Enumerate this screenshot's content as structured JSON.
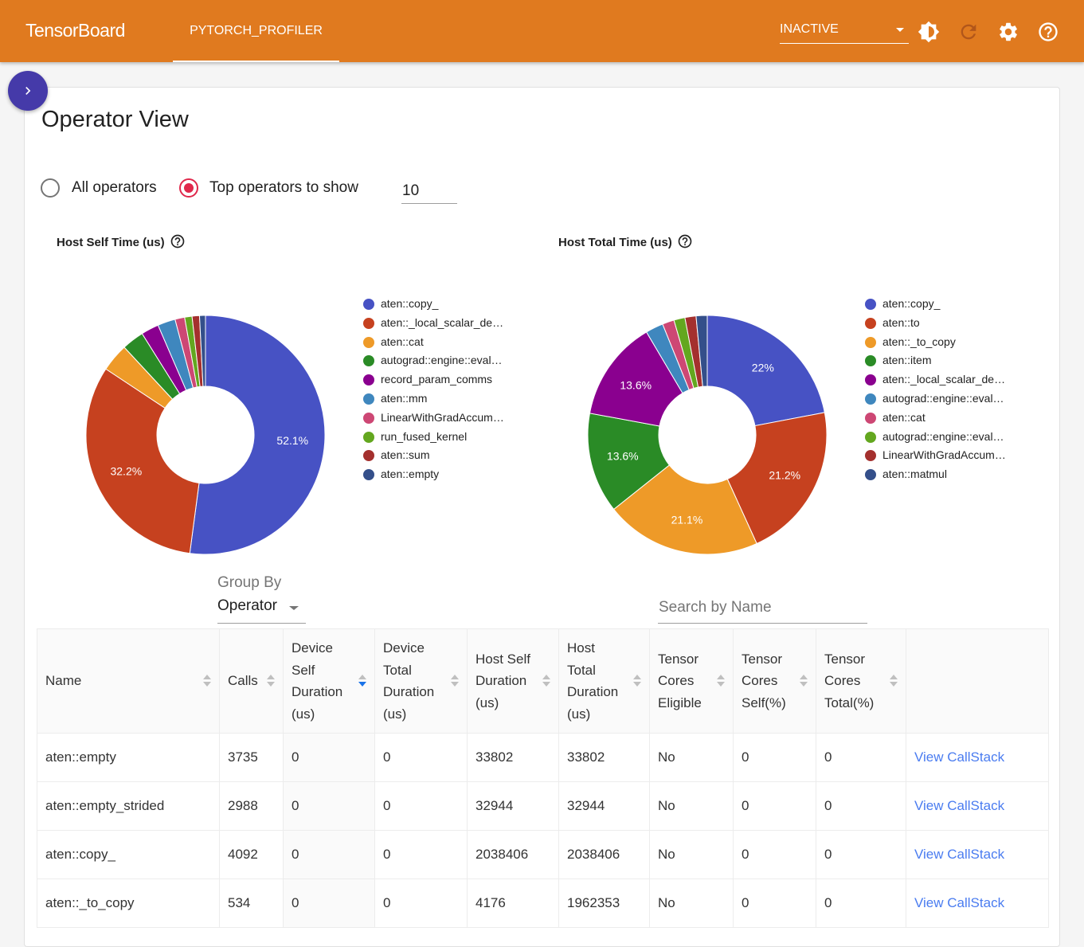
{
  "app": {
    "title": "TensorBoard",
    "active_tab": "PYTORCH_PROFILER",
    "run_selector": {
      "value": "INACTIVE"
    },
    "icons": [
      "brightness-icon",
      "reload-icon",
      "settings-icon",
      "help-icon"
    ]
  },
  "sidebar_toggle": {
    "icon": "chevron-right-icon"
  },
  "page": {
    "title": "Operator View",
    "options": {
      "all_label": "All operators",
      "top_label": "Top operators to show",
      "selected": "top",
      "top_value": "10"
    }
  },
  "chart_data": [
    {
      "type": "pie",
      "style": "donut",
      "title": "Host Self Time (us)",
      "legend_position": "right",
      "labels": [
        "aten::copy_",
        "aten::_local_scalar_de…",
        "aten::cat",
        "autograd::engine::eval…",
        "record_param_comms",
        "aten::mm",
        "LinearWithGradAccum…",
        "run_fused_kernel",
        "aten::sum",
        "aten::empty"
      ],
      "values": [
        52.1,
        32.2,
        3.8,
        3.0,
        2.4,
        2.4,
        1.3,
        1.0,
        1.0,
        0.8
      ],
      "value_labels": [
        "52.1%",
        "32.2%",
        "",
        "",
        "",
        "",
        "",
        "",
        "",
        ""
      ],
      "colors": [
        "#4752c4",
        "#c6411f",
        "#ee9a28",
        "#2a8b26",
        "#8a008f",
        "#3f87be",
        "#cd4774",
        "#63a71f",
        "#a4302e",
        "#344f8a"
      ]
    },
    {
      "type": "pie",
      "style": "donut",
      "title": "Host Total Time (us)",
      "legend_position": "right",
      "labels": [
        "aten::copy_",
        "aten::to",
        "aten::_to_copy",
        "aten::item",
        "aten::_local_scalar_de…",
        "autograd::engine::eval…",
        "aten::cat",
        "autograd::engine::eval…",
        "LinearWithGradAccum…",
        "aten::matmul"
      ],
      "values": [
        22.0,
        21.2,
        21.1,
        13.6,
        13.6,
        2.4,
        1.6,
        1.5,
        1.5,
        1.5
      ],
      "value_labels": [
        "22%",
        "21.2%",
        "21.1%",
        "13.6%",
        "13.6%",
        "",
        "",
        "",
        "",
        ""
      ],
      "colors": [
        "#4752c4",
        "#c6411f",
        "#ee9a28",
        "#2a8b26",
        "#8a008f",
        "#3f87be",
        "#cd4774",
        "#63a71f",
        "#a4302e",
        "#344f8a"
      ]
    }
  ],
  "controls": {
    "group_by_label": "Group By",
    "group_by_value": "Operator",
    "search_placeholder": "Search by Name"
  },
  "table": {
    "columns": [
      "Name",
      "Calls",
      "Device Self Duration (us)",
      "Device Total Duration (us)",
      "Host Self Duration (us)",
      "Host Total Duration (us)",
      "Tensor Cores Eligible",
      "Tensor Cores Self(%)",
      "Tensor Cores Total(%)",
      ""
    ],
    "sorted_column": "Device Self Duration (us)",
    "sort_direction": "descending",
    "rows": [
      [
        "aten::empty",
        "3735",
        "0",
        "0",
        "33802",
        "33802",
        "No",
        "0",
        "0",
        "View CallStack"
      ],
      [
        "aten::empty_strided",
        "2988",
        "0",
        "0",
        "32944",
        "32944",
        "No",
        "0",
        "0",
        "View CallStack"
      ],
      [
        "aten::copy_",
        "4092",
        "0",
        "0",
        "2038406",
        "2038406",
        "No",
        "0",
        "0",
        "View CallStack"
      ],
      [
        "aten::_to_copy",
        "534",
        "0",
        "0",
        "4176",
        "1962353",
        "No",
        "0",
        "0",
        "View CallStack"
      ]
    ]
  }
}
